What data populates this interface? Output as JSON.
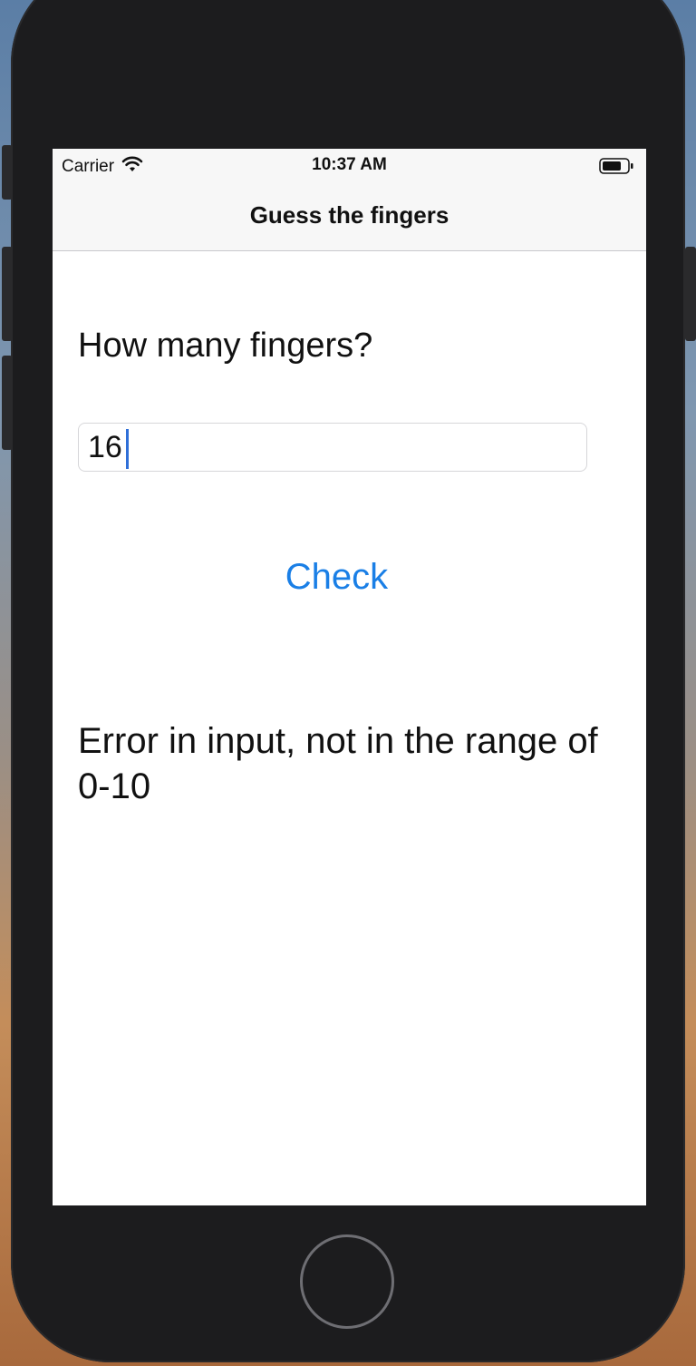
{
  "status_bar": {
    "carrier": "Carrier",
    "time": "10:37 AM",
    "wifi_icon": "wifi-icon",
    "battery_icon": "battery-icon"
  },
  "nav": {
    "title": "Guess the fingers"
  },
  "main": {
    "question": "How many fingers?",
    "input_value": "16",
    "check_label": "Check",
    "result_message": "Error in input, not in the range of 0-10"
  },
  "colors": {
    "accent": "#1a7fe6",
    "caret": "#2f6fd8",
    "device_frame": "#1c1c1e"
  }
}
